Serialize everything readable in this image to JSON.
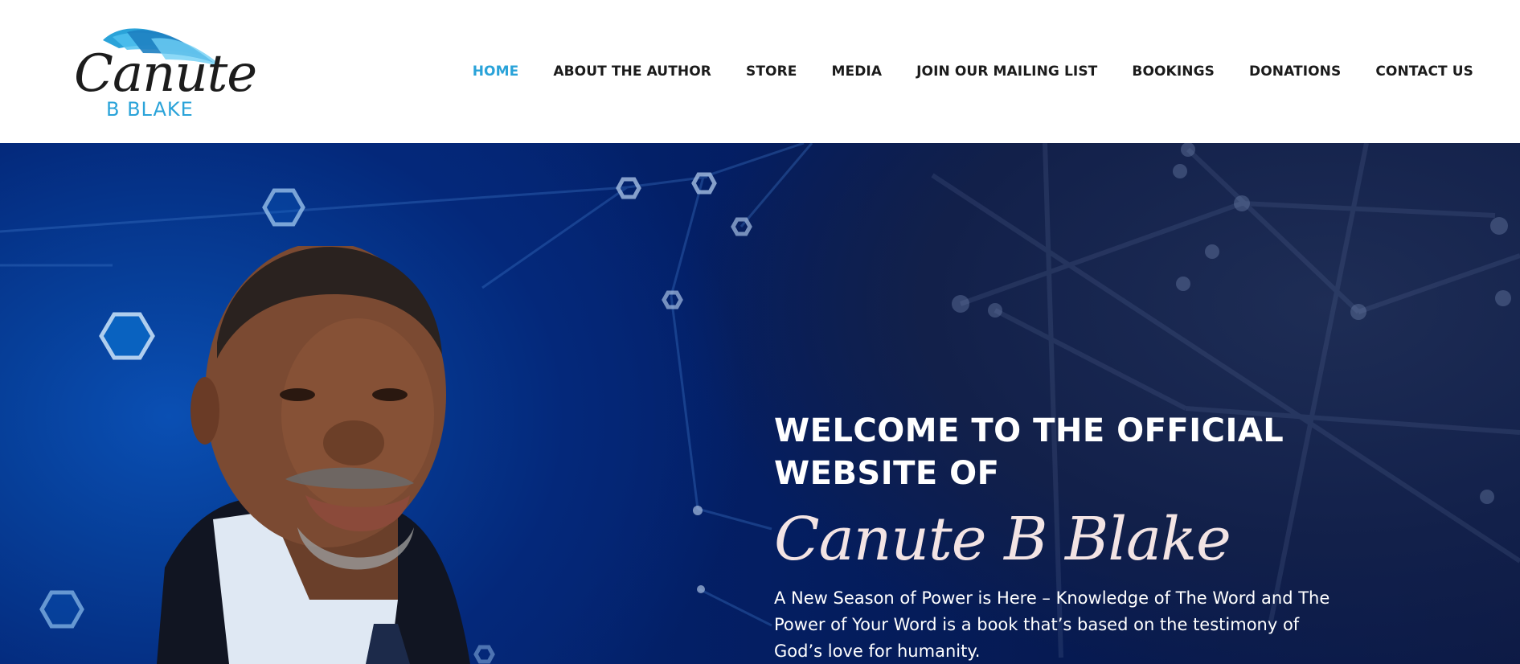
{
  "logo": {
    "script_text": "Canute",
    "sub_text": "B BLAKE",
    "brand_blue": "#2aa3d9"
  },
  "nav": {
    "items": [
      {
        "label": "HOME",
        "active": true
      },
      {
        "label": "ABOUT THE AUTHOR",
        "active": false
      },
      {
        "label": "STORE",
        "active": false
      },
      {
        "label": "MEDIA",
        "active": false
      },
      {
        "label": "JOIN OUR MAILING LIST",
        "active": false
      },
      {
        "label": "BOOKINGS",
        "active": false
      },
      {
        "label": "DONATIONS",
        "active": false
      },
      {
        "label": "CONTACT US",
        "active": false
      }
    ],
    "active_color": "#2aa3d9",
    "text_color": "#1b1b1b"
  },
  "hero": {
    "welcome_line1": "WELCOME TO THE OFFICIAL",
    "welcome_line2": "WEBSITE OF",
    "name_script": "Canute B Blake",
    "tagline": "A New Season of Power is Here – Knowledge of The Word and The Power of Your Word is a book that’s based on the testimony of God’s love for humanity.",
    "background_color": "#041f66",
    "name_color": "#f3e4e4"
  }
}
